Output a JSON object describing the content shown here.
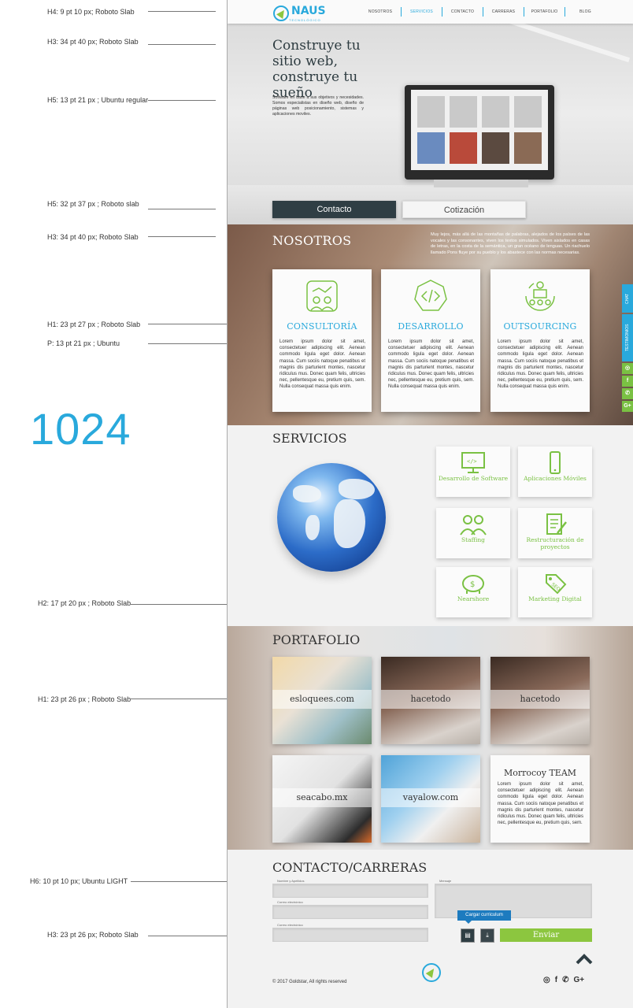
{
  "annotations": [
    "H4: 9 pt 10 px; Roboto Slab",
    "H3: 34 pt 40 px; Roboto Slab",
    "H5: 13 pt 21 px ; Ubuntu regular",
    "H5: 32 pt 37 px ; Roboto slab",
    "H3: 34 pt 40 px; Roboto Slab",
    "H1: 23 pt 27 px ; Roboto Slab",
    "P: 13 pt 21 px ; Ubuntu",
    "H2: 17 pt 20 px ; Roboto Slab",
    "H1: 23 pt 26 px ; Roboto Slab",
    "H6: 10 pt 10 px; Ubuntu LIGHT",
    "H3: 23 pt 26 px; Roboto Slab"
  ],
  "breakpoint_label": "1024",
  "brand": {
    "name": "NAUS",
    "sub": "TECNOLÓGICO"
  },
  "nav": {
    "items": [
      "NOSOTROS",
      "SERVICIOS",
      "CONTACTO",
      "CARRERAS",
      "PORTAFOLIO",
      "BLOG"
    ],
    "active": "SERVICIOS"
  },
  "hero": {
    "title": "Construye tu sitio web, construye tu sueño",
    "description": "Software en base a sus objetivos y necesidades. Somos especialistas en diseño web, diseño de páginas web posicionamiento, sistemas y aplicaciones moviles.",
    "btn_contacto": "Contacto",
    "btn_cotizacion": "Cotización"
  },
  "nosotros": {
    "title": "NOSOTROS",
    "text": "Muy lejos, más allá de las montañas de palabras, alejados de los países de las vocales y las consonantes, viven los textos simulados. Viven aislados en casas de letras, en la costa de la semántica, un gran océano de lenguas. Un riachuelo llamado Pons fluye por su pueblo y los abastece con las normas necesarias.",
    "cards": [
      {
        "title": "CONSULTORÍA",
        "icon": "consulting-icon"
      },
      {
        "title": "DESARROLLO",
        "icon": "code-icon"
      },
      {
        "title": "OUTSOURCING",
        "icon": "outsourcing-icon"
      }
    ],
    "card_text": "Lorem ipsum dolor sit amet, consectetuer adipiscing elit. Aenean commodo ligula eget dolor. Aenean massa. Cum sociis natoque penatibus et magnis dis parturient montes, nascetur ridiculus mus. Donec quam felis, ultricies nec, pellentesque eu, pretium quis, sem. Nulla consequat massa quis enim."
  },
  "side_tabs": {
    "chat": "CHAT",
    "testimonios": "TESTIMONIOS",
    "icons": [
      "instagram-icon",
      "facebook-icon",
      "whatsapp-icon",
      "google-plus-icon"
    ]
  },
  "servicios": {
    "title": "SERVICIOS",
    "items": [
      {
        "label": "Desarrollo de Software",
        "icon": "monitor-code-icon"
      },
      {
        "label": "Aplicaciones Móviles",
        "icon": "mobile-icon"
      },
      {
        "label": "Staffing",
        "icon": "people-icon"
      },
      {
        "label": "Restructuración de proyectos",
        "icon": "document-edit-icon"
      },
      {
        "label": "Nearshore",
        "icon": "piggy-bank-icon"
      },
      {
        "label": "Marketing Digital",
        "icon": "seo-tag-icon"
      }
    ]
  },
  "portafolio": {
    "title": "PORTAFOLIO",
    "tiles": [
      "esloquees.com",
      "hacetodo",
      "hacetodo",
      "seacabo.mx",
      "vayalow.com"
    ],
    "featured": {
      "title": "Morrocoy TEAM",
      "text": "Lorem ipsum dolor sit amet, consectetuer adipiscing elit. Aenean commodo ligula eget dolor. Aenean massa. Cum sociis natoque penatibus et magnis dis parturient montes, nascetur ridiculus mus. Donec quam felis, ultricies nec, pellentesque eu, pretium quis, sem."
    }
  },
  "contacto": {
    "title": "CONTACTO/CARRERAS",
    "labels": {
      "name": "Nombre y Apellidos",
      "email1": "Correo electrónico",
      "email2": "Correo electrónico",
      "message": "Mensaje"
    },
    "cv_tooltip": "Cargar curriculum",
    "send": "Enviar"
  },
  "footer": {
    "copyright": "© 2017 Goldstar, All rights reserved",
    "social": [
      "instagram-icon",
      "facebook-icon",
      "whatsapp-icon",
      "google-plus-icon"
    ]
  },
  "colors": {
    "accent_blue": "#29a9dc",
    "accent_green": "#8cc63f",
    "dark": "#2f3e44"
  }
}
